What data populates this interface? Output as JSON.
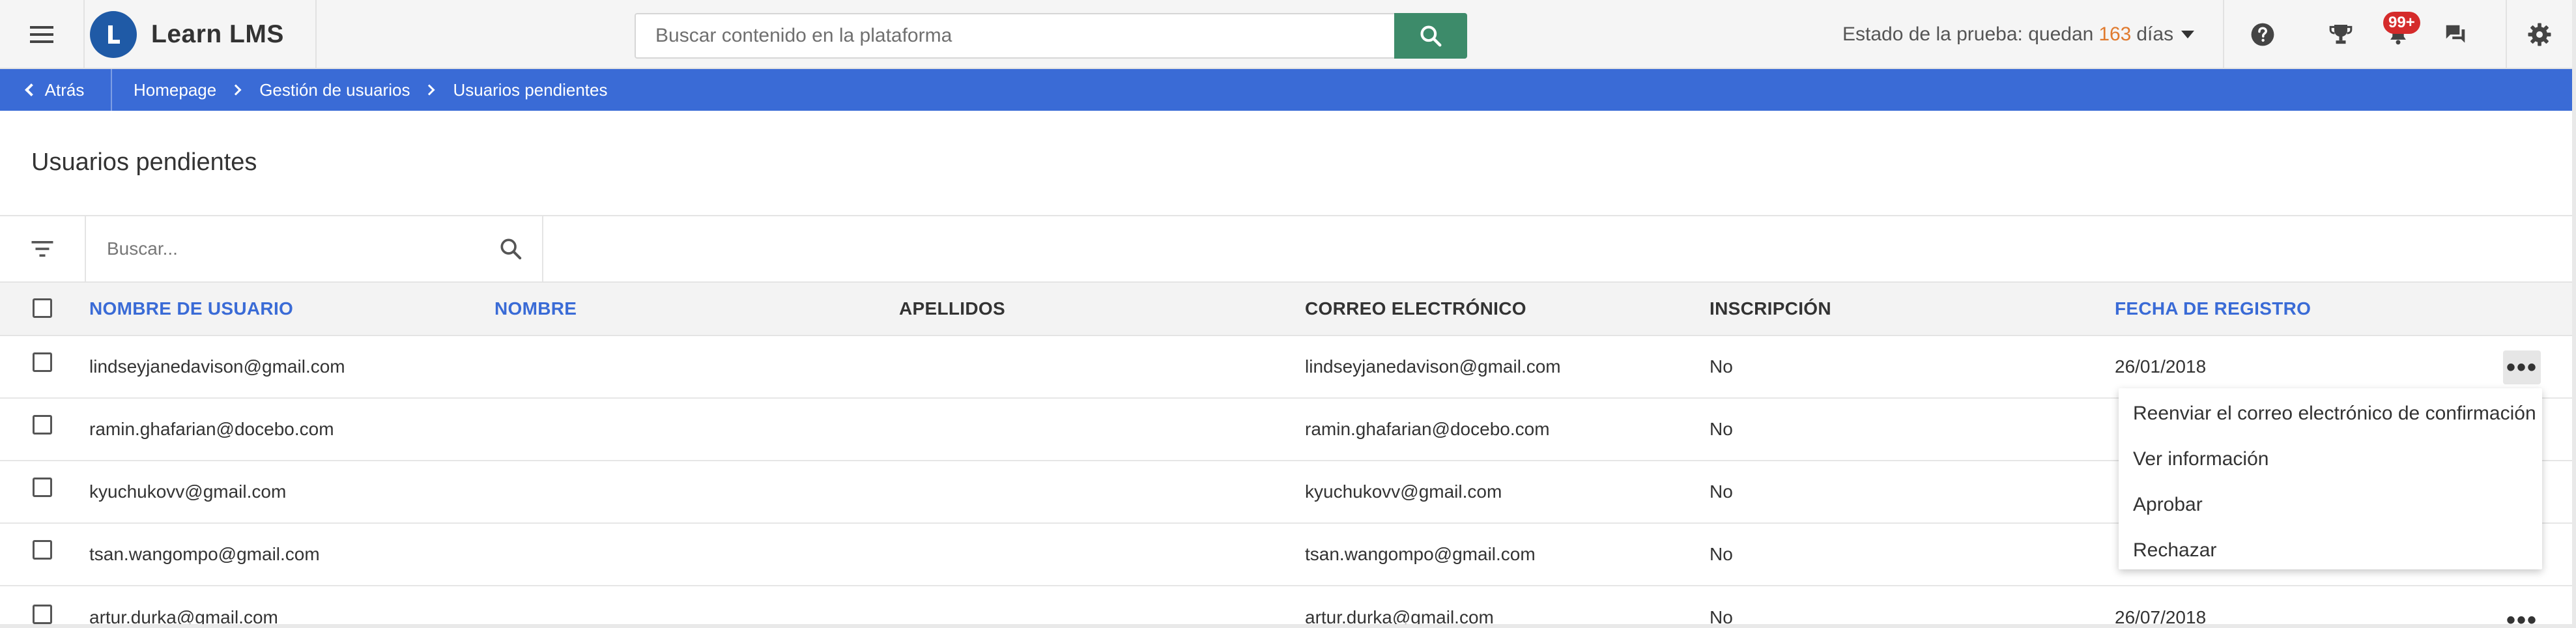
{
  "header": {
    "brand": "Learn LMS",
    "search_placeholder": "Buscar contenido en la plataforma",
    "trial_prefix": "Estado de la prueba: quedan",
    "trial_days": "163",
    "trial_suffix": "días",
    "notification_badge": "99+",
    "icons": [
      "menu-icon",
      "search-icon",
      "help-icon",
      "trophy-icon",
      "bell-icon",
      "chat-icon",
      "gear-icon"
    ]
  },
  "breadcrumb": {
    "back_label": "Atrás",
    "items": [
      "Homepage",
      "Gestión de usuarios",
      "Usuarios pendientes"
    ]
  },
  "page": {
    "title": "Usuarios pendientes",
    "search_placeholder": "Buscar..."
  },
  "table": {
    "columns": [
      "Nombre de usuario",
      "Nombre",
      "Apellidos",
      "Correo electrónico",
      "Inscripción",
      "Fecha de registro"
    ],
    "rows": [
      {
        "username": "lindseyjanedavison@gmail.com",
        "first_name": "",
        "last_name": "",
        "email": "lindseyjanedavison@gmail.com",
        "enrollment": "No",
        "date": "26/01/2018"
      },
      {
        "username": "ramin.ghafarian@docebo.com",
        "first_name": "",
        "last_name": "",
        "email": "ramin.ghafarian@docebo.com",
        "enrollment": "No",
        "date": ""
      },
      {
        "username": "kyuchukovv@gmail.com",
        "first_name": "",
        "last_name": "",
        "email": "kyuchukovv@gmail.com",
        "enrollment": "No",
        "date": ""
      },
      {
        "username": "tsan.wangompo@gmail.com",
        "first_name": "",
        "last_name": "",
        "email": "tsan.wangompo@gmail.com",
        "enrollment": "No",
        "date": ""
      },
      {
        "username": "artur.durka@gmail.com",
        "first_name": "",
        "last_name": "",
        "email": "artur.durka@gmail.com",
        "enrollment": "No",
        "date": "26/07/2018"
      }
    ]
  },
  "context_menu": {
    "items": [
      "Reenviar el correo electrónico de confirmación",
      "Ver información",
      "Aprobar",
      "Rechazar"
    ]
  },
  "colors": {
    "accent_blue": "#3a6bd6",
    "search_button_green": "#3d8b6a",
    "trial_days_orange": "#e07a2e",
    "badge_red": "#d52b2b"
  }
}
